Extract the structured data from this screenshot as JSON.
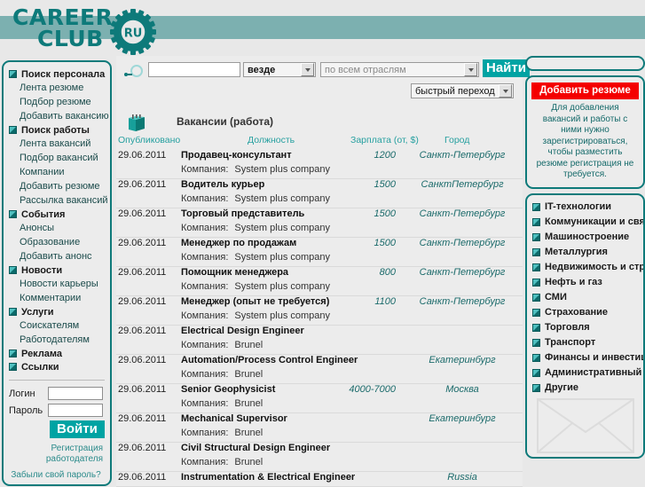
{
  "header": {
    "logo_line1": "CAREER",
    "logo_line2": "CLUB",
    "logo_badge": "RU",
    "brand_color": "#0e7a7a",
    "band_color": "#7cb0b0"
  },
  "search": {
    "magnifier_icon": "search-icon",
    "query_value": "",
    "query_placeholder": "",
    "where_value": "везде",
    "branch_value": "по всем отраслям",
    "quick_jump_value": "быстрый переход",
    "find_label": "Найти"
  },
  "left_sidebar": {
    "groups": [
      {
        "title": "Поиск персонала",
        "items": [
          "Лента резюме",
          "Подбор резюме",
          "Добавить вакансию"
        ]
      },
      {
        "title": "Поиск работы",
        "items": [
          "Лента вакансий",
          "Подбор вакансий",
          "Компании",
          "Добавить резюме",
          "Рассылка вакансий"
        ]
      },
      {
        "title": "События",
        "items": [
          "Анонсы",
          "Образование",
          "Добавить анонс"
        ]
      },
      {
        "title": "Новости",
        "items": [
          "Новости карьеры",
          "Комментарии"
        ]
      },
      {
        "title": "Услуги",
        "items": [
          "Соискателям",
          "Работодателям"
        ]
      },
      {
        "title": "Реклама",
        "items": []
      },
      {
        "title": "Ссылки",
        "items": []
      }
    ],
    "login": {
      "login_label": "Логин",
      "login_value": "",
      "password_label": "Пароль",
      "password_value": "",
      "submit_label": "Войти",
      "register_link": "Регистрация работодателя",
      "forgot_link": "Забыли свой пароль?"
    }
  },
  "vacancies": {
    "icon": "book-icon",
    "title": "Вакансии (работа)",
    "columns": {
      "date": "Опубликовано",
      "position": "Должность",
      "salary": "Зарплата (от, $)",
      "city": "Город"
    },
    "company_label": "Компания:",
    "rows": [
      {
        "date": "29.06.2011",
        "position": "Продавец-консультант",
        "salary": "1200",
        "city": "Санкт-Петербург",
        "company": "System plus company"
      },
      {
        "date": "29.06.2011",
        "position": "Водитель курьер",
        "salary": "1500",
        "city": "СанктПетербург",
        "company": "System plus company"
      },
      {
        "date": "29.06.2011",
        "position": "Торговый представитель",
        "salary": "1500",
        "city": "Санкт-Петербург",
        "company": "System plus company"
      },
      {
        "date": "29.06.2011",
        "position": "Менеджер по продажам",
        "salary": "1500",
        "city": "Санкт-Петербург",
        "company": "System plus company"
      },
      {
        "date": "29.06.2011",
        "position": "Помощник менеджера",
        "salary": "800",
        "city": "Санкт-Петербург",
        "company": "System plus company"
      },
      {
        "date": "29.06.2011",
        "position": "Менеджер (опыт не требуется)",
        "salary": "1100",
        "city": "Санкт-Петербург",
        "company": "System plus company"
      },
      {
        "date": "29.06.2011",
        "position": "Electrical Design Engineer",
        "salary": "",
        "city": "",
        "company": "Brunel"
      },
      {
        "date": "29.06.2011",
        "position": "Automation/Process Control Engineer",
        "salary": "",
        "city": "Екатеринбург",
        "company": "Brunel"
      },
      {
        "date": "29.06.2011",
        "position": "Senior Geophysicist",
        "salary": "4000-7000",
        "city": "Москва",
        "company": "Brunel"
      },
      {
        "date": "29.06.2011",
        "position": "Mechanical Supervisor",
        "salary": "",
        "city": "Екатеринбург",
        "company": "Brunel"
      },
      {
        "date": "29.06.2011",
        "position": "Civil Structural Design Engineer",
        "salary": "",
        "city": "",
        "company": "Brunel"
      },
      {
        "date": "29.06.2011",
        "position": "Instrumentation & Electrical Engineer",
        "salary": "",
        "city": "Russia",
        "company": ""
      }
    ]
  },
  "right_sidebar": {
    "add_resume_label": "Добавить резюме",
    "add_resume_color": "#f40000",
    "resume_note": "Для добавления вакансий и работы с ними нужно зарегистрироваться, чтобы разместить резюме регистрация не требуется.",
    "categories": [
      "IT-технологии",
      "Коммуникации и связь",
      "Машиностроение",
      "Металлургия",
      "Недвижимость и строительство",
      "Нефть и газ",
      "СМИ",
      "Страхование",
      "Торговля",
      "Транспорт",
      "Финансы и инвестиции",
      "Административный персонал",
      "Другие"
    ],
    "envelope_icon": "envelope-icon"
  }
}
